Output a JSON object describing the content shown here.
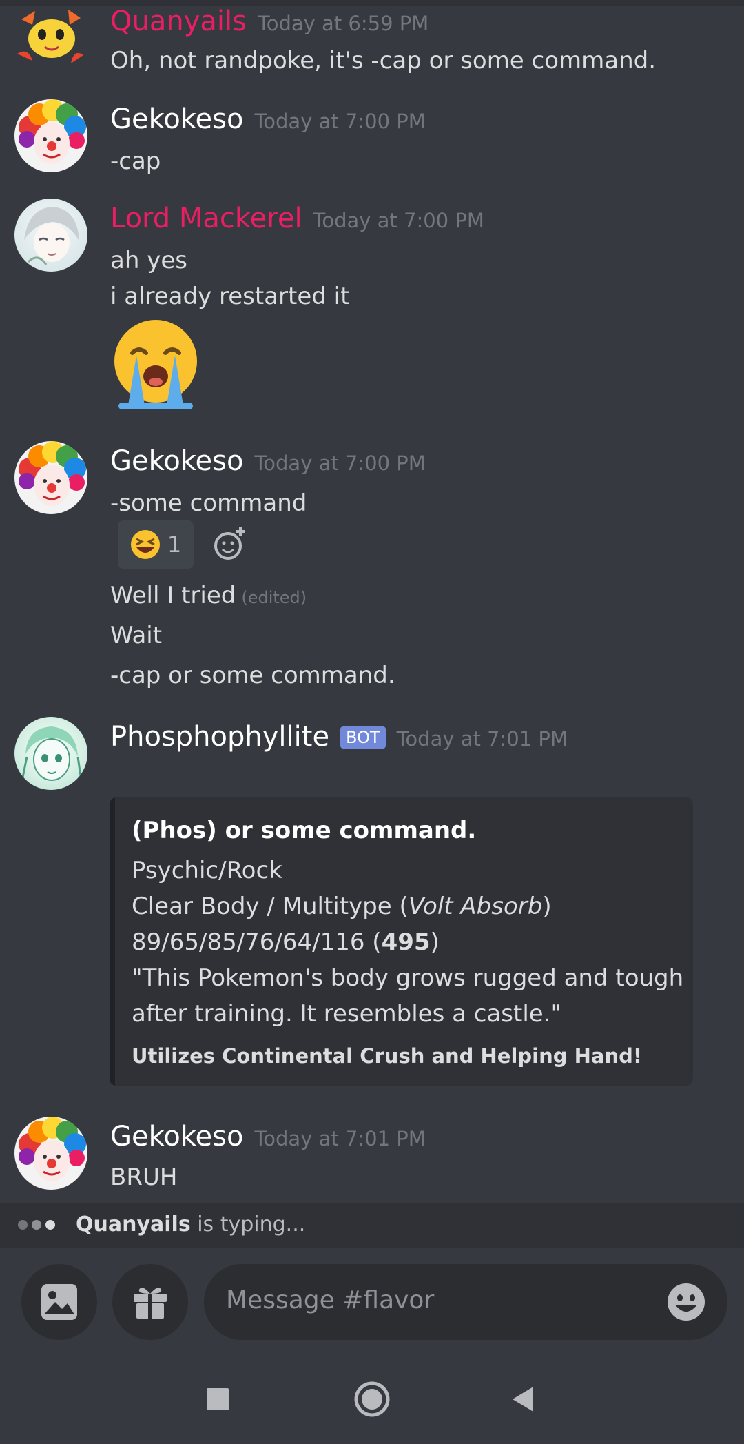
{
  "channel_placeholder": "Message #flavor",
  "messages": [
    {
      "author": "Quanyails",
      "timestamp": "Today at 6:59 PM",
      "lines": [
        "Oh, not randpoke, it's -cap or some command."
      ]
    },
    {
      "author": "Gekokeso",
      "timestamp": "Today at 7:00 PM",
      "lines": [
        "-cap"
      ]
    },
    {
      "author": "Lord Mackerel",
      "timestamp": "Today at 7:00 PM",
      "lines": [
        "ah yes",
        "i already restarted it"
      ]
    },
    {
      "author": "Gekokeso",
      "timestamp": "Today at 7:00 PM",
      "lines": [
        "-some command",
        "Well I tried",
        "Wait",
        "-cap or some command."
      ],
      "edited_tag": "(edited)",
      "reaction_count": "1"
    },
    {
      "author": "Phosphophyllite",
      "timestamp": "Today at 7:01 PM",
      "badge": "BOT"
    },
    {
      "author": "Gekokeso",
      "timestamp": "Today at 7:01 PM",
      "lines": [
        "BRUH"
      ]
    }
  ],
  "embed": {
    "title": "(Phos) or some command.",
    "types": "Psychic/Rock",
    "abilities_prefix": "Clear Body / Multitype (",
    "hidden_ability": "Volt Absorb",
    "abilities_suffix": ")",
    "stats": "89/65/85/76/64/116 (",
    "bst": "495",
    "stats_suffix": ")",
    "desc_line1": "\"This Pokemon's body grows rugged and tough",
    "desc_line2": "after training. It resembles a castle.\"",
    "footer": "Utilizes Continental Crush and Helping Hand!"
  },
  "typing": {
    "user": "Quanyails",
    "suffix": " is typing..."
  },
  "colors": {
    "background": "#36393f",
    "username_default": "#ffffff",
    "username_pink": "#e91e63",
    "timestamp": "#72767d",
    "bot_badge": "#7289da"
  },
  "icons": {
    "attach": "image-icon",
    "gift": "gift-icon",
    "emoji": "smiley-icon",
    "reaction": "laughing-emoji-icon",
    "add_reaction": "add-reaction-icon",
    "nav": [
      "square-recents-icon",
      "circle-home-icon",
      "triangle-back-icon"
    ]
  }
}
